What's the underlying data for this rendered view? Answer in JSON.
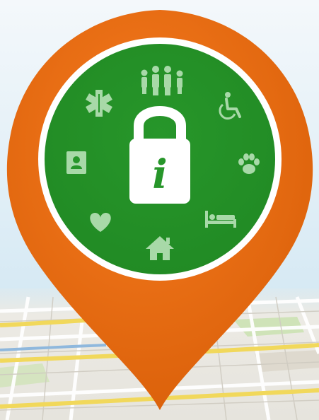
{
  "colors": {
    "pin": "#ef6f13",
    "pin_dark": "#d85e08",
    "badge": "#27962a",
    "badge_ring": "#ffffff",
    "glyph": "#ffffff",
    "glyph_faded": "#9fd59f",
    "sky_top": "#f4f8fb",
    "sky_bottom": "#c9e3f1",
    "map_base": "#eceae4",
    "map_road_yellow": "#f1d85b",
    "map_road_white": "#ffffff",
    "map_park": "#cfe3b8",
    "map_water": "#b9d7ee"
  },
  "icons": {
    "center": "padlock-info-icon",
    "ring": [
      "family-icon",
      "wheelchair-icon",
      "paw-icon",
      "bed-icon",
      "home-icon",
      "heart-icon",
      "contact-card-icon",
      "medical-star-icon"
    ]
  },
  "lock_letter": "i"
}
